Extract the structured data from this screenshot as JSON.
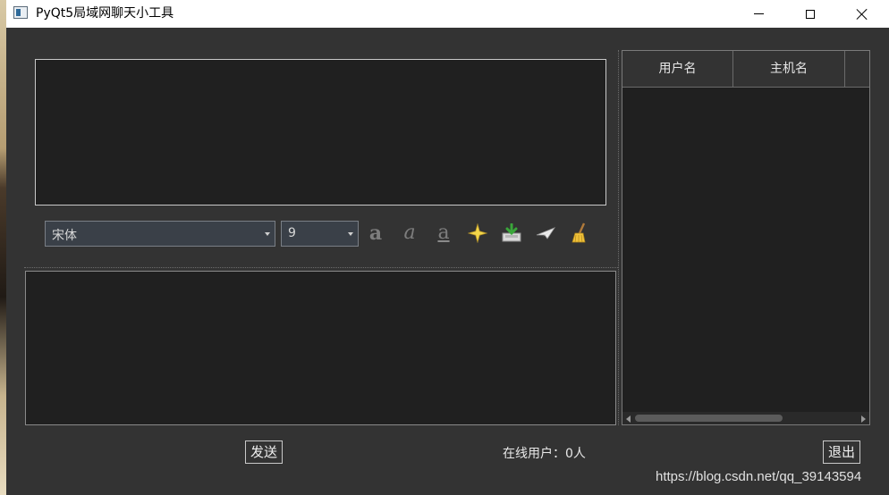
{
  "window": {
    "title": "PyQt5局域网聊天小工具"
  },
  "toolbar": {
    "font_combo_value": "宋体",
    "size_combo_value": "9",
    "bold_glyph": "a",
    "italic_glyph": "a",
    "underline_glyph": "a",
    "icons": [
      "bold-icon",
      "italic-icon",
      "underline-icon",
      "color-icon",
      "save-icon",
      "send-plane-icon",
      "clear-broom-icon"
    ]
  },
  "user_table": {
    "columns": [
      "用户名",
      "主机名",
      ""
    ]
  },
  "footer": {
    "send_label": "发送",
    "online_text": "在线用户：0人",
    "exit_label": "退出"
  },
  "watermark": "https://blog.csdn.net/qq_39143594"
}
